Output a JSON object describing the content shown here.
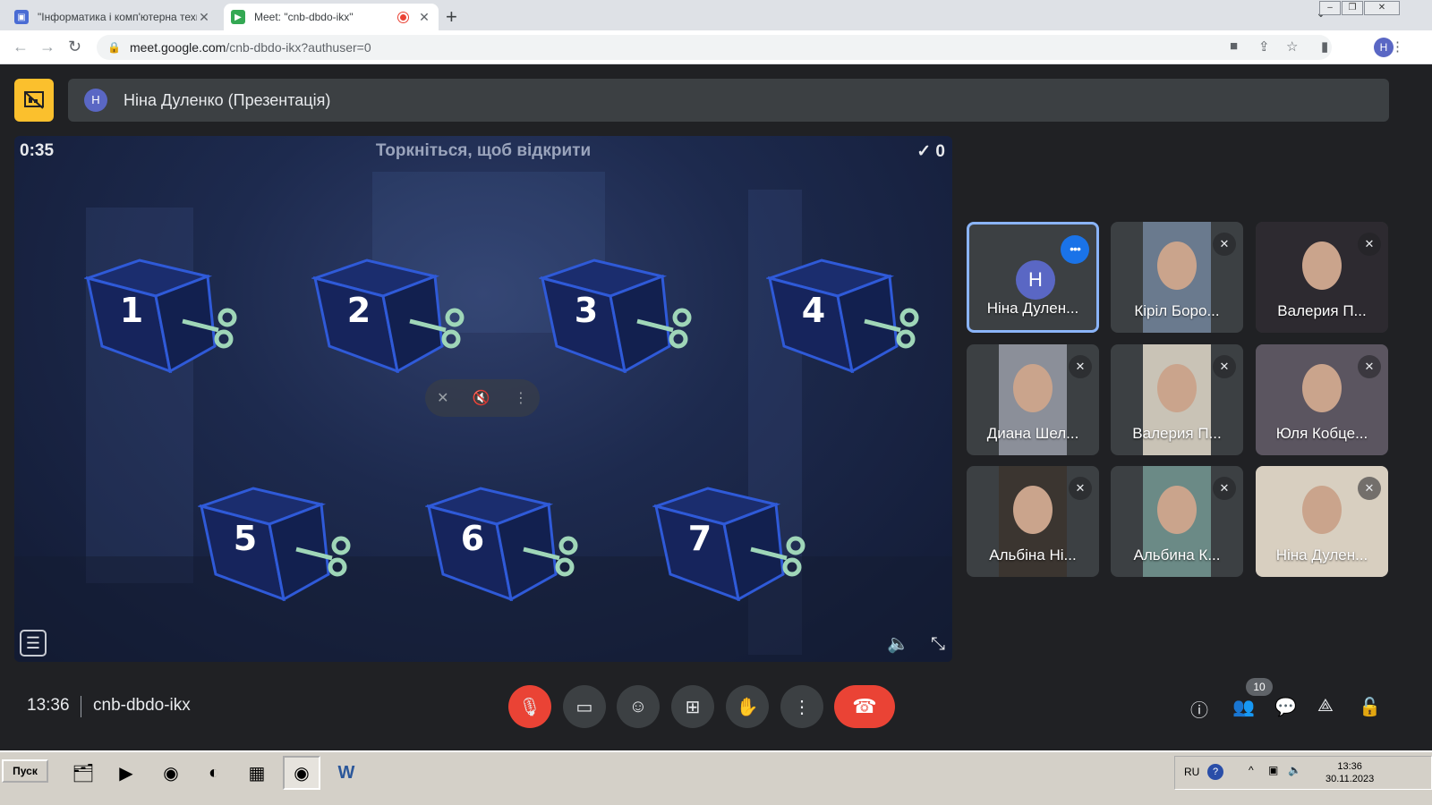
{
  "browser": {
    "tabs": [
      {
        "title": "\"Інформатика і комп'ютерна техні",
        "active": false
      },
      {
        "title": "Meet: \"cnb-dbdo-ikx\"",
        "active": true
      }
    ],
    "url_host": "meet.google.com",
    "url_path": "/cnb-dbdo-ikx?authuser=0",
    "profile_initial": "H"
  },
  "presenter": {
    "initial": "H",
    "label": "Ніна Дуленко (Презентація)"
  },
  "presentation": {
    "timer": "0:35",
    "hint": "Торкніться, щоб відкрити",
    "score": "✓ 0",
    "boxes": [
      "1",
      "2",
      "3",
      "4",
      "5",
      "6",
      "7"
    ]
  },
  "participants": [
    {
      "name": "Ніна Дулен...",
      "initial": "H",
      "selected": true,
      "avatar": true
    },
    {
      "name": "Кіріл Боро...",
      "muted": true
    },
    {
      "name": "Валерия П...",
      "muted": true
    },
    {
      "name": "Диана Шел...",
      "muted": true
    },
    {
      "name": "Валерия П...",
      "muted": true
    },
    {
      "name": "Юля Кобце...",
      "muted": true
    },
    {
      "name": "Альбіна Ні...",
      "muted": true
    },
    {
      "name": "Альбина К...",
      "muted": true
    },
    {
      "name": "Ніна Дулен...",
      "muted": true
    }
  ],
  "meeting": {
    "time": "13:36",
    "code": "cnb-dbdo-ikx",
    "people_count": "10"
  },
  "taskbar": {
    "start_label": "Пуск",
    "lang": "RU",
    "clock_time": "13:36",
    "clock_date": "30.11.2023"
  },
  "colors": {
    "accent": "#8ab4f8",
    "danger": "#ea4335",
    "present_yellow": "#fbc02d",
    "meet_bg": "#202124"
  }
}
